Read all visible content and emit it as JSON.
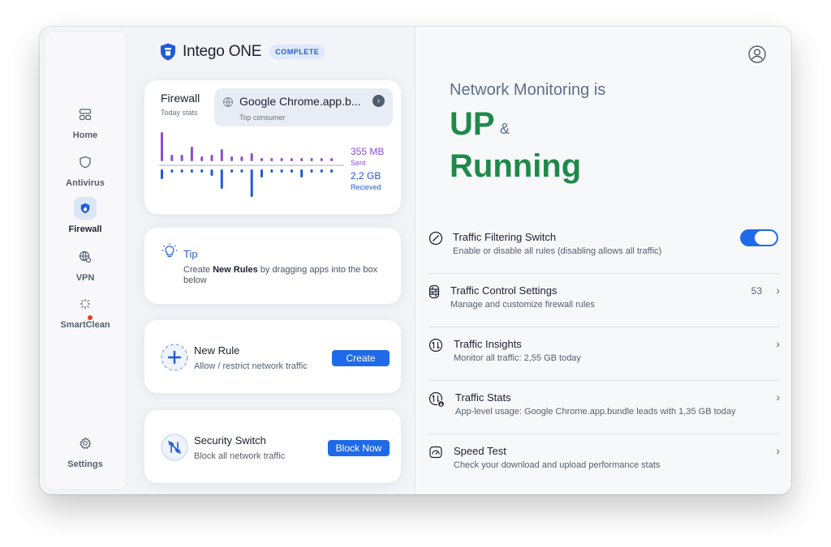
{
  "window": {
    "traffic_lights": [
      "close",
      "minimize",
      "zoom"
    ]
  },
  "sidebar": {
    "items": [
      {
        "label": "Home",
        "icon": "home-icon",
        "active": false
      },
      {
        "label": "Antivirus",
        "icon": "shield-icon",
        "active": false
      },
      {
        "label": "Firewall",
        "icon": "firewall-icon",
        "active": true
      },
      {
        "label": "VPN",
        "icon": "vpn-globe-icon",
        "active": false
      },
      {
        "label": "SmartClean",
        "icon": "sparkle-icon",
        "active": false,
        "alert_dot": true
      },
      {
        "label": "Settings",
        "icon": "gear-icon",
        "active": false
      }
    ]
  },
  "brand": {
    "name": "Intego ONE",
    "badge": "COMPLETE"
  },
  "firewall_card": {
    "title": "Firewall",
    "subtitle": "Today stats",
    "top_consumer_name": "Google Chrome.app.b...",
    "top_consumer_label": "Top consumer",
    "sent_value": "355 MB",
    "sent_label": "Sent",
    "received_value": "2,2 GB",
    "received_label": "Recieved",
    "sent_color": "#8a4fcf",
    "received_color": "#1f5ad8"
  },
  "tip_card": {
    "title": "Tip",
    "text_before": "Create ",
    "text_bold": "New Rules",
    "text_after": " by dragging apps into the box below"
  },
  "new_rule_card": {
    "title": "New Rule",
    "subtitle": "Allow / restrict network traffic",
    "button": "Create"
  },
  "security_card": {
    "title": "Security Switch",
    "subtitle": "Block all network traffic",
    "button": "Block Now"
  },
  "status": {
    "line1": "Network Monitoring is",
    "up": "UP",
    "amp": "&",
    "running": "Running",
    "accent_color": "#1e8a4a"
  },
  "rows": [
    {
      "title": "Traffic Filtering Switch",
      "subtitle": "Enable or disable all rules (disabling allows all traffic)",
      "icon": "filter-slash-icon",
      "toggle_on": true
    },
    {
      "title": "Traffic Control Settings",
      "subtitle": "Manage and customize firewall rules",
      "icon": "brick-wall-icon",
      "count": "53"
    },
    {
      "title": "Traffic Insights",
      "subtitle": "Monitor all traffic: 2,55 GB today",
      "icon": "traffic-arrows-icon"
    },
    {
      "title": "Traffic Stats",
      "subtitle": "App-level usage: Google Chrome.app.bundle leads with 1,35 GB today",
      "icon": "traffic-stats-icon"
    },
    {
      "title": "Speed Test",
      "subtitle": "Check your download and upload performance stats",
      "icon": "speedometer-icon"
    }
  ]
}
